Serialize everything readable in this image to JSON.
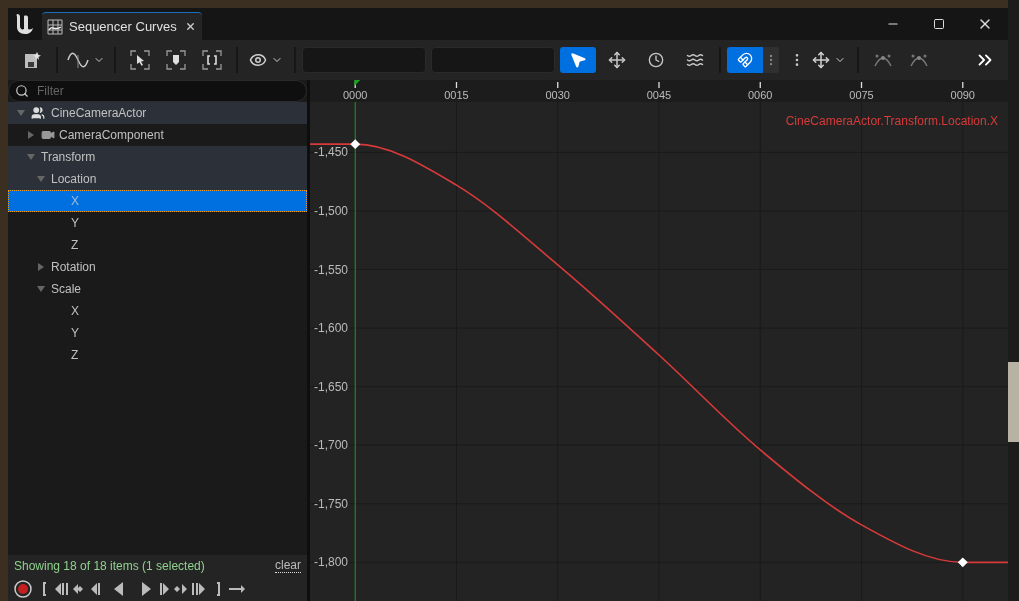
{
  "window": {
    "tab_title": "Sequencer Curves"
  },
  "toolbar": [
    {
      "kind": "save"
    },
    {
      "kind": "sep"
    },
    {
      "kind": "curve-menu"
    },
    {
      "kind": "sep"
    },
    {
      "kind": "frame-selection"
    },
    {
      "kind": "frame-key"
    },
    {
      "kind": "frame-all"
    },
    {
      "kind": "sep"
    },
    {
      "kind": "view-menu"
    },
    {
      "kind": "sep"
    },
    {
      "kind": "field"
    },
    {
      "kind": "field"
    },
    {
      "kind": "tool-select",
      "selected": true
    },
    {
      "kind": "tool-transform",
      "selected": false
    },
    {
      "kind": "tool-retime",
      "selected": false
    },
    {
      "kind": "tool-multi",
      "selected": false
    },
    {
      "kind": "sep"
    },
    {
      "kind": "snap",
      "on": true
    },
    {
      "kind": "axis-snap"
    },
    {
      "kind": "more"
    },
    {
      "kind": "move-menu"
    },
    {
      "kind": "sep"
    },
    {
      "kind": "tangent-auto"
    },
    {
      "kind": "tangent-break"
    },
    {
      "kind": "overflow"
    }
  ],
  "filter": {
    "placeholder": "Filter"
  },
  "tree": [
    {
      "label": "CineCameraActor",
      "kind": "actor",
      "expanded": true,
      "highlighted": true,
      "selected": false,
      "children": [
        {
          "label": "CameraComponent",
          "kind": "camera",
          "expanded": false,
          "highlighted": false,
          "selected": false
        },
        {
          "label": "Transform",
          "expanded": true,
          "highlighted": true,
          "selected": false,
          "children": [
            {
              "label": "Location",
              "expanded": true,
              "highlighted": true,
              "selected": false,
              "children": [
                {
                  "label": "X",
                  "selected": true
                },
                {
                  "label": "Y",
                  "highlighted": false,
                  "selected": false
                },
                {
                  "label": "Z",
                  "highlighted": false,
                  "selected": false
                }
              ]
            },
            {
              "label": "Rotation",
              "expanded": false,
              "highlighted": false,
              "selected": false
            },
            {
              "label": "Scale",
              "expanded": true,
              "highlighted": false,
              "selected": false,
              "children": [
                {
                  "label": "X",
                  "highlighted": false,
                  "selected": false
                },
                {
                  "label": "Y",
                  "highlighted": false,
                  "selected": false
                },
                {
                  "label": "Z",
                  "highlighted": false,
                  "selected": false
                }
              ]
            }
          ]
        }
      ]
    }
  ],
  "status": {
    "text": "Showing 18 of 18 items (1 selected)",
    "clear": "clear"
  },
  "graph": {
    "chart_data": {
      "type": "line",
      "grid": true,
      "x": [
        -6.7,
        0,
        15,
        30,
        45,
        60,
        75,
        90,
        96.7
      ],
      "series": [
        {
          "name": "CineCameraActor.Transform.Location.X",
          "color": "#d83a3a",
          "values": [
            -1443,
            -1443,
            -1478,
            -1546,
            -1623,
            -1704,
            -1768,
            -1800,
            -1800
          ]
        }
      ],
      "xlim": [
        -6.7,
        96.7
      ],
      "ylim": [
        -1833,
        -1407
      ],
      "xticks": [
        {
          "value": 0,
          "label": "0000"
        },
        {
          "value": 15,
          "label": "0015"
        },
        {
          "value": 30,
          "label": "0030"
        },
        {
          "value": 45,
          "label": "0045"
        },
        {
          "value": 60,
          "label": "0060"
        },
        {
          "value": 75,
          "label": "0075"
        },
        {
          "value": 90,
          "label": "0090"
        }
      ],
      "yticks": [
        {
          "value": -1450,
          "label": "-1,450"
        },
        {
          "value": -1500,
          "label": "-1,500"
        },
        {
          "value": -1550,
          "label": "-1,550"
        },
        {
          "value": -1600,
          "label": "-1,600"
        },
        {
          "value": -1650,
          "label": "-1,650"
        },
        {
          "value": -1700,
          "label": "-1,700"
        },
        {
          "value": -1750,
          "label": "-1,750"
        },
        {
          "value": -1800,
          "label": "-1,800"
        }
      ],
      "ref_lines": [
        {
          "axis": "x",
          "value": 0,
          "color": "#22a022"
        }
      ]
    }
  }
}
